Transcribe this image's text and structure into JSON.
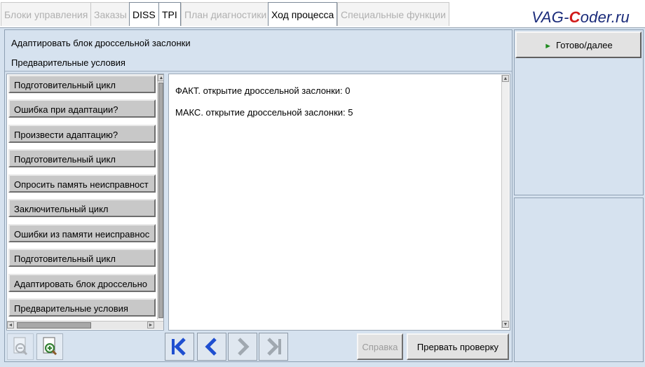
{
  "tabs": [
    {
      "label": "Блоки управления",
      "active": false
    },
    {
      "label": "Заказы",
      "active": false
    },
    {
      "label": "DISS",
      "active": true
    },
    {
      "label": "TPI",
      "active": true
    },
    {
      "label": "План диагностики",
      "active": false
    },
    {
      "label": "Ход процесса",
      "active": true
    },
    {
      "label": "Специальные функции",
      "active": false
    }
  ],
  "watermark": {
    "part1": "VAG-",
    "part2": "C",
    "part3": "oder.ru"
  },
  "header": {
    "title": "Адаптировать блок дроссельной заслонки",
    "subtitle": "Предварительные условия"
  },
  "steps": [
    "Подготовительный цикл",
    "Ошибка при адаптации?",
    "Произвести адаптацию?",
    "Подготовительный цикл",
    "Опросить память неисправност",
    "Заключительный цикл",
    "Ошибки из памяти неисправнос",
    "Подготовительный цикл",
    "Адаптировать блок дроссельно",
    "Предварительные условия"
  ],
  "content": {
    "line1": "ФАКТ. открытие дроссельной заслонки: 0",
    "line2": "МАКС. открытие дроссельной заслонки: 5"
  },
  "toolbar": {
    "help_label": "Справка",
    "abort_label": "Прервать проверку"
  },
  "side": {
    "done_label": "Готово/далее"
  },
  "colors": {
    "accent": "#1f4fd0",
    "panel": "#d6e2ef",
    "play": "#1f8a1f"
  }
}
